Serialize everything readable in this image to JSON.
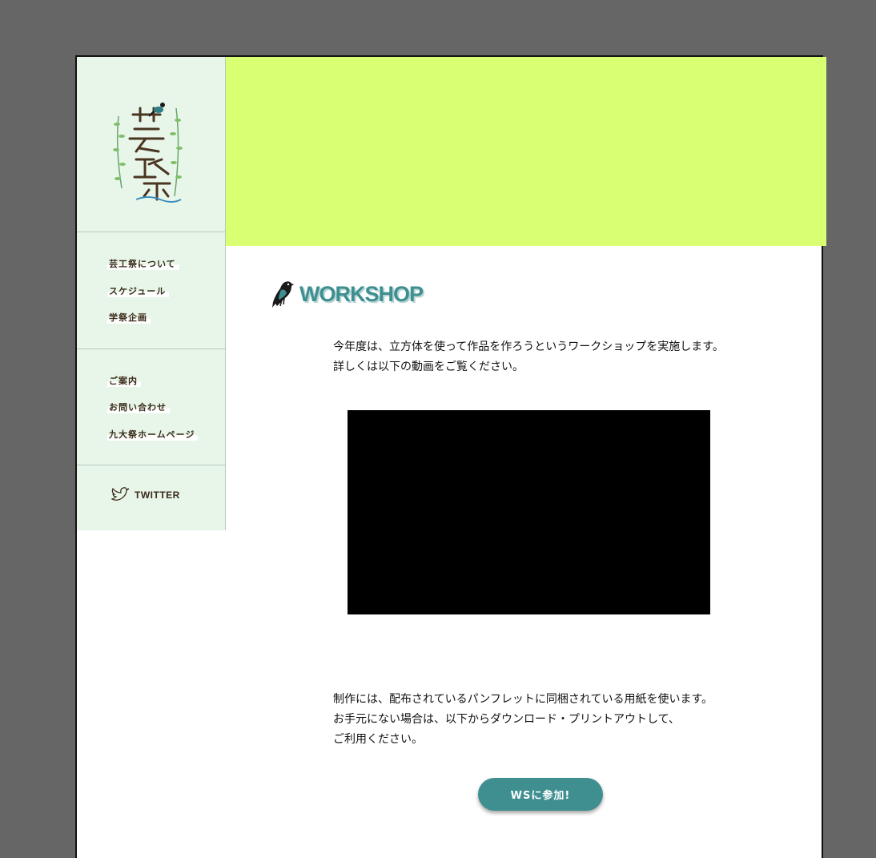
{
  "sidebar": {
    "logo_alt": "芸工祭",
    "nav_primary": [
      {
        "label": "芸工祭について"
      },
      {
        "label": "スケジュール"
      },
      {
        "label": "学祭企画"
      }
    ],
    "nav_secondary": [
      {
        "label": "ご案内"
      },
      {
        "label": "お問い合わせ"
      },
      {
        "label": "九大祭ホームページ"
      }
    ],
    "twitter_label": "TWITTER"
  },
  "main": {
    "section_title": "WORKSHOP",
    "intro_lines": [
      "今年度は、立方体を使って作品を作ろうというワークショップを実施します。",
      "詳しくは以下の動画をご覧ください。"
    ],
    "body_lines": [
      "制作には、配布されているパンフレットに同梱されている用紙を使います。",
      "お手元にない場合は、以下からダウンロード・プリントアウトして、",
      "ご利用ください。"
    ],
    "button_label": "WSに参加!"
  },
  "colors": {
    "backdrop": "#666666",
    "sidebar_bg": "#e8f6ea",
    "hero_bg": "#d9ff73",
    "accent": "#3f8f91",
    "nav_text": "#3a2a18"
  },
  "icons": {
    "logo": "leaf-logo",
    "title_bird": "bird-icon",
    "twitter": "twitter-bird-icon"
  }
}
